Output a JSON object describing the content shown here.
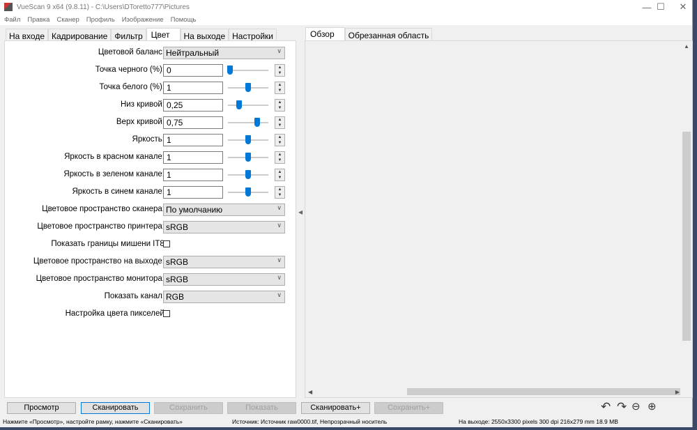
{
  "window": {
    "title": "VueScan 9 x64 (9.8.11) - C:\\Users\\DToretto777\\Pictures",
    "minimize": "—",
    "maximize": "☐",
    "close": "✕"
  },
  "menu": [
    "Файл",
    "Правка",
    "Сканер",
    "Профиль",
    "Изображение",
    "Помощь"
  ],
  "left_tabs": [
    {
      "label": "На входе"
    },
    {
      "label": "Кадрирование"
    },
    {
      "label": "Фильтр"
    },
    {
      "label": "Цвет",
      "active": true
    },
    {
      "label": "На выходе"
    },
    {
      "label": "Настройки"
    }
  ],
  "right_tabs": [
    {
      "label": "Обзор",
      "active": true
    },
    {
      "label": "Обрезанная область"
    }
  ],
  "settings": [
    {
      "type": "select",
      "label": "Цветовой баланс:",
      "value": "Нейтральный"
    },
    {
      "type": "number",
      "label": "Точка черного (%):",
      "value": "0",
      "slider": 0.05
    },
    {
      "type": "number",
      "label": "Точка белого (%):",
      "value": "1",
      "slider": 0.5
    },
    {
      "type": "number",
      "label": "Низ кривой:",
      "value": "0,25",
      "slider": 0.28
    },
    {
      "type": "number",
      "label": "Верх кривой:",
      "value": "0,75",
      "slider": 0.72
    },
    {
      "type": "number",
      "label": "Яркость:",
      "value": "1",
      "slider": 0.5
    },
    {
      "type": "number",
      "label": "Яркость в красном канале:",
      "value": "1",
      "slider": 0.5
    },
    {
      "type": "number",
      "label": "Яркость в зеленом канале:",
      "value": "1",
      "slider": 0.5
    },
    {
      "type": "number",
      "label": "Яркость в синем канале:",
      "value": "1",
      "slider": 0.5
    },
    {
      "type": "select",
      "label": "Цветовое пространство сканера:",
      "value": "По умолчанию"
    },
    {
      "type": "select",
      "label": "Цветовое пространство принтера:",
      "value": "sRGB"
    },
    {
      "type": "checkbox",
      "label": "Показать границы мишени IT8:",
      "checked": false
    },
    {
      "type": "select",
      "label": "Цветовое пространство на выходе:",
      "value": "sRGB"
    },
    {
      "type": "select",
      "label": "Цветовое пространство монитора:",
      "value": "sRGB"
    },
    {
      "type": "select",
      "label": "Показать канал:",
      "value": "RGB"
    },
    {
      "type": "checkbox",
      "label": "Настройка цвета пикселей:",
      "checked": false
    }
  ],
  "buttons": [
    {
      "label": "Просмотр",
      "state": "normal"
    },
    {
      "label": "Сканировать",
      "state": "default"
    },
    {
      "label": "Сохранить",
      "state": "disabled"
    },
    {
      "label": "Показать",
      "state": "disabled"
    },
    {
      "label": "Сканировать+",
      "state": "normal"
    },
    {
      "label": "Сохранить+",
      "state": "disabled"
    }
  ],
  "tools": [
    "rotate-left-icon",
    "rotate-right-icon",
    "zoom-out-icon",
    "zoom-in-icon"
  ],
  "status": {
    "hint": "Нажмите «Просмотр», настройте рамку, нажмите «Сканировать»",
    "source": "Источник: Источник raw0000.tif, Непрозрачный носитель",
    "output": "На выходе: 2550x3300 pixels 300 dpi 216x279 mm 18.9 MB"
  },
  "colors": {
    "accent": "#0078d7"
  }
}
